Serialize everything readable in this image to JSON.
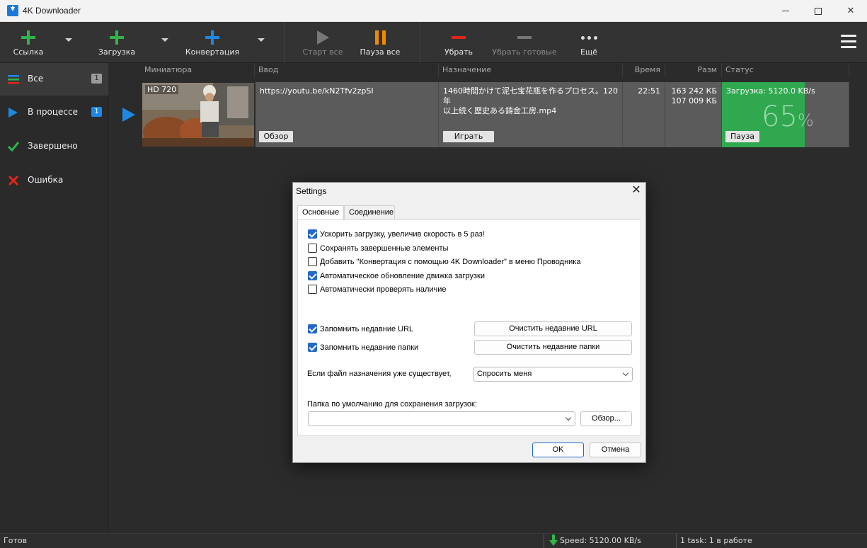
{
  "window": {
    "title": "4K Downloader"
  },
  "toolbar": {
    "link_label": "Ссылка",
    "download_label": "Загрузка",
    "convert_label": "Конвертация",
    "start_all_label": "Старт все",
    "pause_all_label": "Пауза все",
    "remove_label": "Убрать",
    "remove_done_label": "Убрать готовые",
    "more_label": "Ещё"
  },
  "sidebar": {
    "items": [
      {
        "label": "Все",
        "count": "1"
      },
      {
        "label": "В процессе",
        "count": "1"
      },
      {
        "label": "Завершено"
      },
      {
        "label": "Ошибка"
      }
    ]
  },
  "table": {
    "columns": [
      "Миниатюра",
      "Ввод",
      "Назначение",
      "Время",
      "Разм",
      "Статус"
    ],
    "rows": [
      {
        "quality": "HD 720",
        "input": "https://youtu.be/kN2Tfv2zpSI",
        "browse_label": "Обзор",
        "destination_line1": "1460時間かけて泥七宝花瓶を作るプロセス。120年",
        "destination_line2": "以上続く歴史ある鋳金工房.mp4",
        "play_label": "Играть",
        "time": "22:51",
        "size_total": "163 242 КБ",
        "size_done": "107 009 КБ",
        "status_text": "Загрузка: 5120.0 KB/s",
        "progress_percent": 65,
        "progress_number": "65",
        "progress_sign": "%",
        "pause_label": "Пауза"
      }
    ]
  },
  "statusbar": {
    "state": "Готов",
    "speed": "Speed: 5120.00 KB/s",
    "tasks": "1 task: 1 в работе"
  },
  "dialog": {
    "title": "Settings",
    "tabs": [
      "Основные",
      "Соединение"
    ],
    "options": [
      {
        "label": "Ускорить загрузку, увеличив скорость в 5 раз!",
        "checked": true
      },
      {
        "label": "Сохранять завершенные элементы",
        "checked": false
      },
      {
        "label": "Добавить \"Конвертация с помощью 4K Downloader\" в меню Проводника",
        "checked": false
      },
      {
        "label": "Автоматическое обновление движка загрузки",
        "checked": true
      },
      {
        "label": "Автоматически проверять наличие",
        "checked": false
      }
    ],
    "remember_urls_label": "Запомнить недавние URL",
    "remember_folders_label": "Запомнить недавние папки",
    "clear_urls_label": "Очистить недавние URL",
    "clear_folders_label": "Очистить недавние папки",
    "file_exists_label": "Если файл назначения уже существует,",
    "file_exists_value": "Спросить меня",
    "default_folder_label": "Папка по умолчанию для сохранения загрузок:",
    "default_folder_value": "",
    "browse_label": "Обзор...",
    "ok_label": "OK",
    "cancel_label": "Отмена"
  }
}
